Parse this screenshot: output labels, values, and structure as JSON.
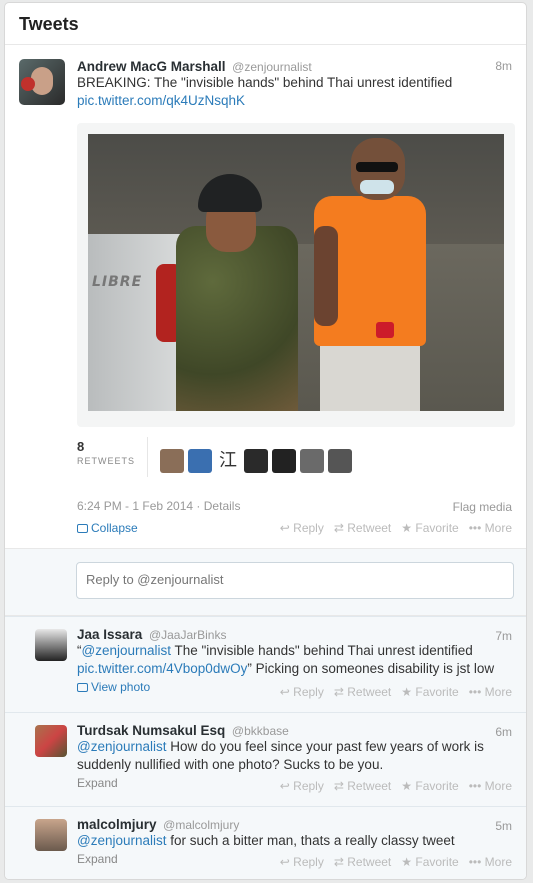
{
  "header": {
    "title": "Tweets"
  },
  "main_tweet": {
    "name": "Andrew MacG Marshall",
    "handle": "@zenjournalist",
    "time": "8m",
    "text": "BREAKING: The \"invisible hands\" behind Thai unrest identified",
    "pic_link": "pic.twitter.com/qk4UzNsqhK",
    "photo_truck_label": "LIBRE",
    "retweet_count": "8",
    "retweet_label": "RETWEETS",
    "retweeter_avatar_colors": [
      "#8a6e58",
      "#3a6fb0",
      "#ffffff",
      "#2a2a2a",
      "#222222",
      "#6a6a6a",
      "#555555"
    ],
    "retweeter_avatar_kanji": "江",
    "timestamp": "6:24 PM - 1 Feb 2014",
    "details_label": "Details",
    "flag_media": "Flag media",
    "collapse": "Collapse",
    "actions": {
      "reply": "Reply",
      "retweet": "Retweet",
      "favorite": "Favorite",
      "more": "More"
    }
  },
  "reply_box": {
    "placeholder": "Reply to @zenjournalist"
  },
  "replies": [
    {
      "name": "Jaa Issara",
      "handle": "@JaaJarBinks",
      "time": "7m",
      "quote_open": "“",
      "mention": "@zenjournalist",
      "text_a": " The \"invisible hands\" behind Thai unrest identified ",
      "link": "pic.twitter.com/4Vbop0dwOy",
      "text_b": "” Picking on someones disability is jst low",
      "footer": "View photo"
    },
    {
      "name": "Turdsak Numsakul Esq",
      "handle": "@bkkbase",
      "time": "6m",
      "mention": "@zenjournalist",
      "text": " How do you feel since your past few years of work is suddenly nullified with one photo? Sucks to be you.",
      "footer": "Expand"
    },
    {
      "name": "malcolmjury",
      "handle": "@malcolmjury",
      "time": "5m",
      "mention": "@zenjournalist",
      "text": " for such a bitter man, thats a really classy tweet",
      "footer": "Expand"
    }
  ],
  "reply_actions": {
    "reply": "Reply",
    "retweet": "Retweet",
    "favorite": "Favorite",
    "more": "More"
  },
  "colors": {
    "link": "#2b7bb9",
    "muted": "#999999",
    "panel_bg": "#f5f8fa"
  }
}
